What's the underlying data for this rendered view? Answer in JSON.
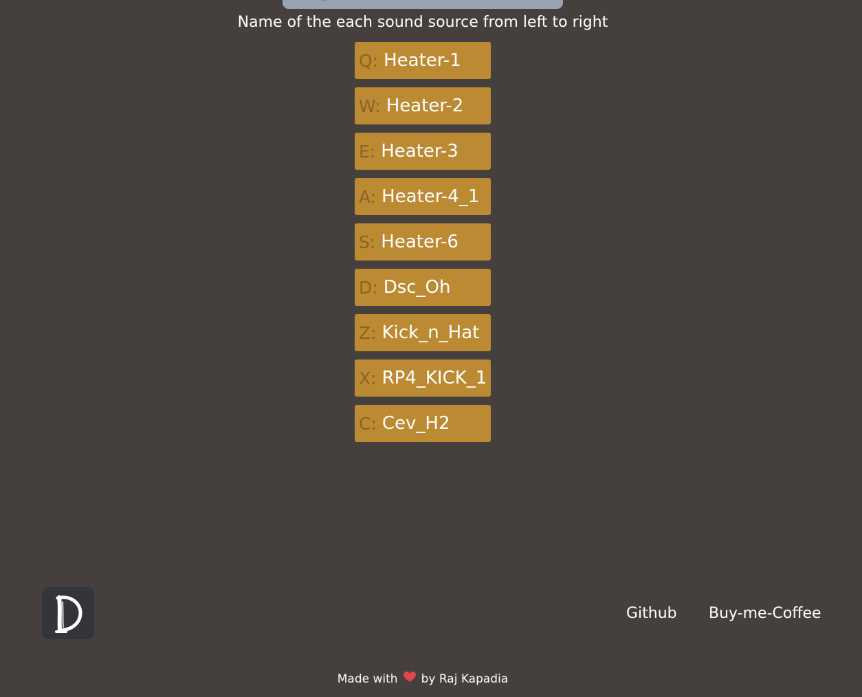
{
  "header": {
    "instruction": "Name of the each sound source from left to right"
  },
  "pads": [
    {
      "key": "Q:",
      "name": "Heater-1"
    },
    {
      "key": "W:",
      "name": "Heater-2"
    },
    {
      "key": "E:",
      "name": "Heater-3"
    },
    {
      "key": "A:",
      "name": "Heater-4_1"
    },
    {
      "key": "S:",
      "name": "Heater-6"
    },
    {
      "key": "D:",
      "name": "Dsc_Oh"
    },
    {
      "key": "Z:",
      "name": "Kick_n_Hat"
    },
    {
      "key": "X:",
      "name": "RP4_KICK_1"
    },
    {
      "key": "C:",
      "name": "Cev_H2"
    }
  ],
  "nav": {
    "logo_icon": "brush-letter-d-logo",
    "github_label": "Github",
    "coffee_label": "Buy-me-Coffee"
  },
  "footer": {
    "made_with": "Made with",
    "heart_icon": "heart-icon",
    "by_author": "by Raj Kapadia"
  },
  "colors": {
    "background": "#45403d",
    "pad": "#bb8a33",
    "pad_key": "#8a6323",
    "top_bar": "#9aa2b4",
    "logo_bg": "#34353b",
    "heart": "#e0474c"
  }
}
